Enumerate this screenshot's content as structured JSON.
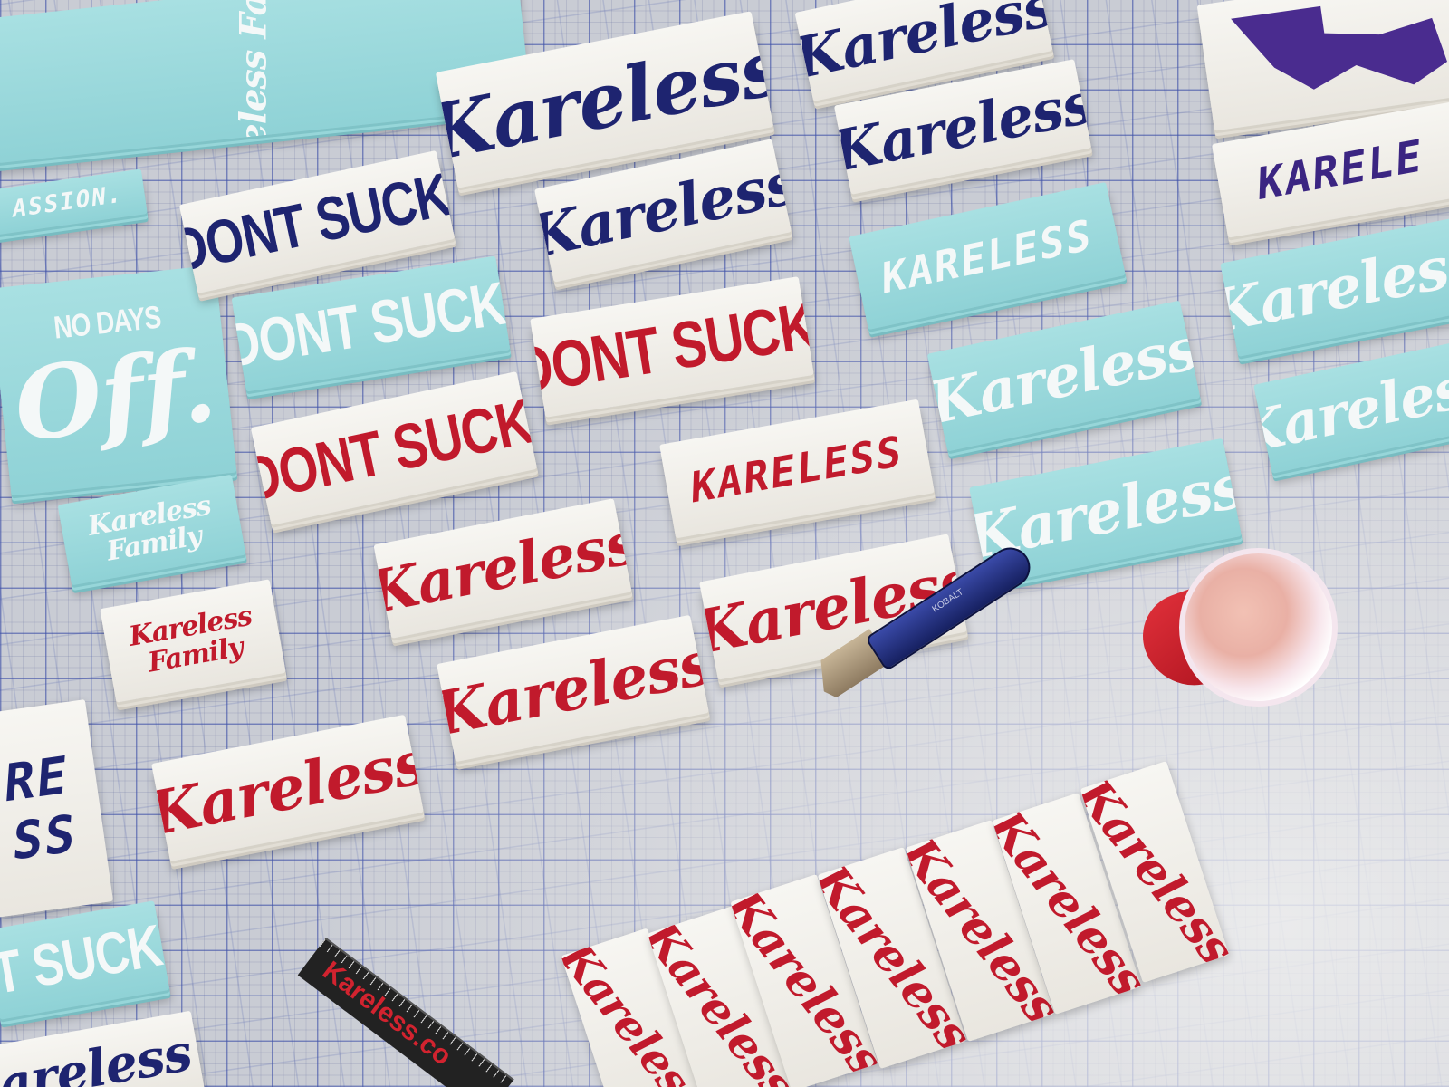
{
  "scene": {
    "surface": "blue-grid cutting mat",
    "colors": {
      "navy": "#1e2470",
      "red": "#c11a2c",
      "aqua": "#9ad8db",
      "white": "#f4f2ec",
      "mat": "#c9ccd4"
    }
  },
  "stickers": {
    "top_left_family": "Kareless Family",
    "passion": "ASSION.",
    "no_days_off_small": "NO DAYS",
    "no_days_off_big": "Off.",
    "dont_suck": "DONT SUCK.",
    "kareless": "Kareless",
    "kareless_tag": "KARELESS",
    "kareless_family_line1": "Kareless",
    "kareless_family_line2": "Family",
    "karele_badge": "KARELE",
    "partial_dont_suck": "T SUCK",
    "partial_kareless": "areless",
    "partial_re": "RE",
    "partial_ss": "SS"
  },
  "props": {
    "ruler_brand": "Kareless.co",
    "knife_brand": "KOBALT"
  }
}
